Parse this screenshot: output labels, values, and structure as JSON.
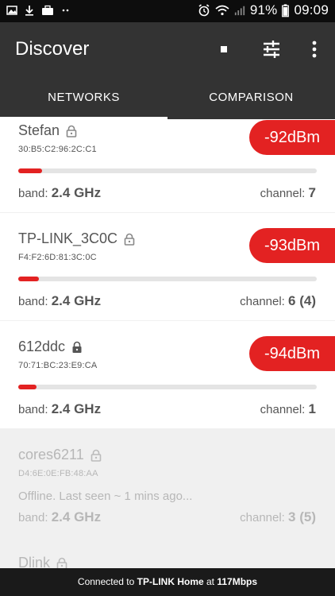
{
  "status_bar": {
    "battery": "91%",
    "time": "09:09"
  },
  "app_bar": {
    "title": "Discover",
    "icons": [
      "stop-icon",
      "tune-icon",
      "more-vert-icon"
    ]
  },
  "tabs": [
    {
      "label": "NETWORKS",
      "selected": true
    },
    {
      "label": "COMPARISON",
      "selected": false
    }
  ],
  "networks": [
    {
      "ssid": "Stefan",
      "bssid": "30:B5:C2:96:2C:C1",
      "rssi": "-92dBm",
      "signal_fraction": 0.08,
      "band_label": "band:",
      "band": "2.4 GHz",
      "channel_label": "channel:",
      "channel": "7"
    },
    {
      "ssid": "TP-LINK_3C0C",
      "bssid": "F4:F2:6D:81:3C:0C",
      "rssi": "-93dBm",
      "signal_fraction": 0.07,
      "band_label": "band:",
      "band": "2.4 GHz",
      "channel_label": "channel:",
      "channel": "6 (4)"
    },
    {
      "ssid": "612ddc",
      "bssid": "70:71:BC:23:E9:CA",
      "rssi": "-94dBm",
      "signal_fraction": 0.06,
      "band_label": "band:",
      "band": "2.4 GHz",
      "channel_label": "channel:",
      "channel": "1"
    },
    {
      "ssid": "cores6211",
      "bssid": "D4:6E:0E:FB:48:AA",
      "offline_text": "Offline. Last seen ~ 1 mins ago...",
      "band_label": "band:",
      "band": "2.4 GHz",
      "channel_label": "channel:",
      "channel": "3 (5)"
    },
    {
      "ssid": "Dlink"
    }
  ],
  "footer": {
    "prefix": "Connected to",
    "network": "TP-LINK Home",
    "middle": "at",
    "speed": "117Mbps"
  },
  "colors": {
    "accent": "#e32222",
    "appbar": "#333333",
    "statusbar": "#0d0d0d"
  }
}
